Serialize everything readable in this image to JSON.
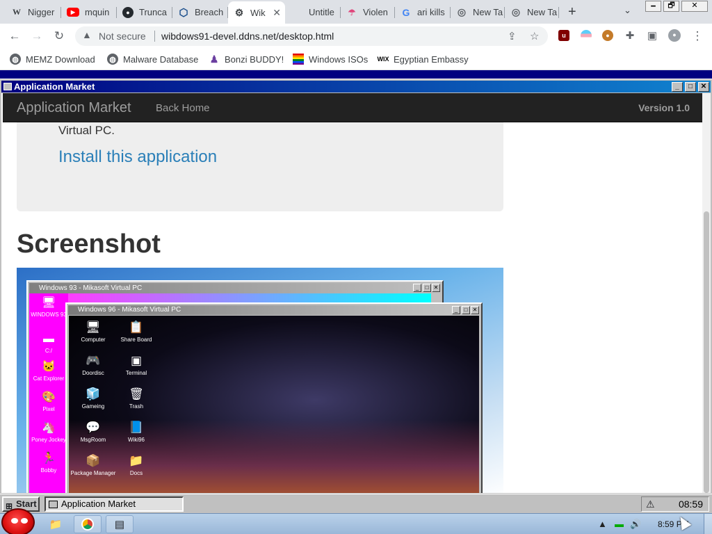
{
  "browser": {
    "tabs": [
      {
        "label": "Nigger",
        "icon": "wikipedia-icon"
      },
      {
        "label": "mquin",
        "icon": "youtube-icon"
      },
      {
        "label": "Trunca",
        "icon": "github-icon"
      },
      {
        "label": "Breach",
        "icon": "hexagon-icon"
      },
      {
        "label": "Wik",
        "icon": "wiki-icon",
        "active": true
      },
      {
        "label": "Untitle",
        "icon": "blank-icon"
      },
      {
        "label": "Violen",
        "icon": "rainbow-icon"
      },
      {
        "label": "ari kills",
        "icon": "google-icon"
      },
      {
        "label": "New Ta",
        "icon": "chrome-icon"
      },
      {
        "label": "New Ta",
        "icon": "chrome-icon"
      }
    ],
    "new_tab_symbol": "+",
    "tab_menu_symbol": "⌄",
    "window_buttons": [
      "🗕",
      "🗗",
      "✕"
    ],
    "security_label": "Not secure",
    "url": "wibdows91-devel.ddns.net/desktop.html",
    "bookmarks": [
      {
        "label": "MEMZ Download",
        "icon": "globe-icon"
      },
      {
        "label": "Malware Database",
        "icon": "globe-icon"
      },
      {
        "label": "Bonzi BUDDY!",
        "icon": "bonzi-icon"
      },
      {
        "label": "Windows ISOs",
        "icon": "rainbow-flag-icon"
      },
      {
        "label": "Egyptian Embassy",
        "icon": "wix-icon"
      }
    ]
  },
  "app_window": {
    "title": "Application Market",
    "nav_brand": "Application Market",
    "nav_back": "Back Home",
    "nav_version": "Version 1.0",
    "card_desc": "Virtual PC.",
    "install_link": "Install this application",
    "screenshot_heading": "Screenshot"
  },
  "screenshot_image": {
    "win93_title": "Windows 93 - Mikasoft Virtual PC",
    "win96_title": "Windows 96 - Mikasoft Virtual PC",
    "win93_icons": [
      "WINDOWS 93",
      "C:/",
      "Cat Explorer",
      "Pixel",
      "Poney Jockey",
      "Bobby"
    ],
    "win96_icons": [
      {
        "label": "Computer",
        "glyph": "🖥"
      },
      {
        "label": "Share Board",
        "glyph": "📋"
      },
      {
        "label": "Doordisc",
        "glyph": "🎮"
      },
      {
        "label": "Terminal",
        "glyph": "▣"
      },
      {
        "label": "Gameing",
        "glyph": "🧊"
      },
      {
        "label": "Trash",
        "glyph": "🗑"
      },
      {
        "label": "MsgRoom",
        "glyph": "💬"
      },
      {
        "label": "Wiki96",
        "glyph": "📘"
      },
      {
        "label": "Package Manager",
        "glyph": "📦"
      },
      {
        "label": "Docs",
        "glyph": "📁"
      }
    ]
  },
  "taskbar95": {
    "start_label": "Start",
    "active_app": "Application Market",
    "clock": "08:59"
  },
  "win7_taskbar": {
    "clock": "8:59 PM"
  }
}
